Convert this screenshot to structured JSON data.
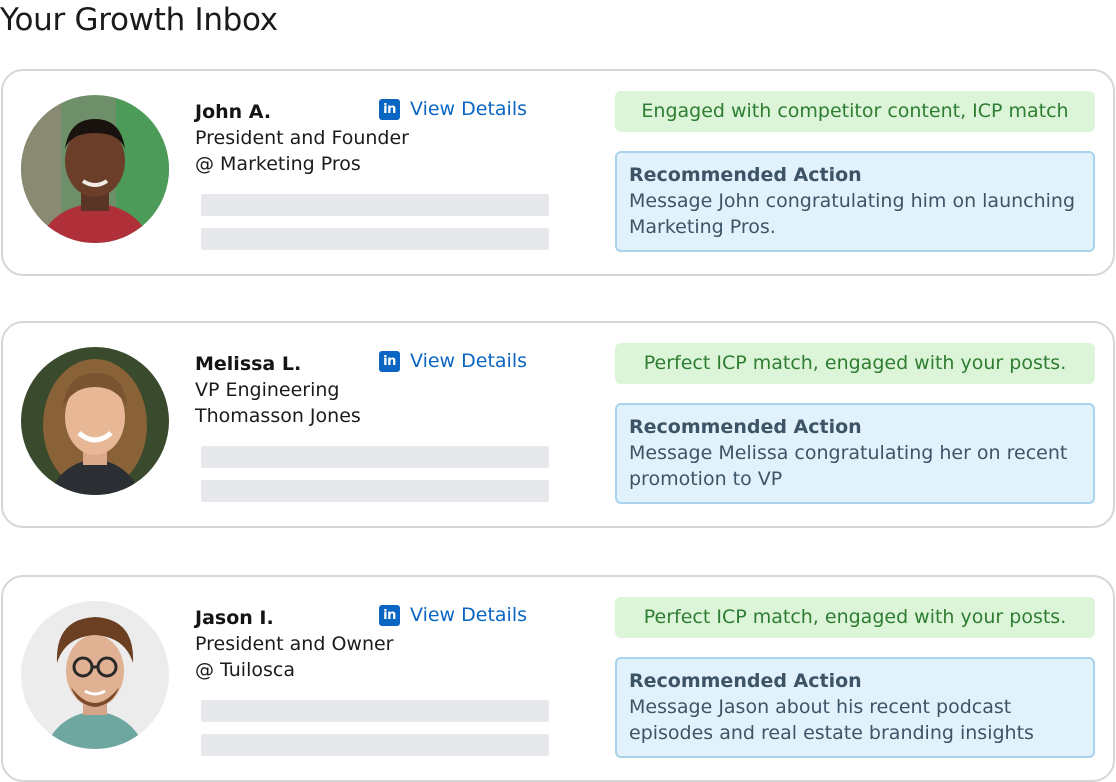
{
  "page": {
    "title": "Your Growth Inbox"
  },
  "common": {
    "view_details": "View Details",
    "linkedin_glyph": "in",
    "recommended_heading": "Recommended Action"
  },
  "colors": {
    "linkedin_blue": "#0a66c2",
    "signal_bg": "#dcf5d8",
    "signal_text": "#2e7d32",
    "action_bg": "#e2f2fc",
    "action_border": "#a9d3ea"
  },
  "leads": [
    {
      "name": "John A.",
      "title": "President and Founder",
      "company": "@ Marketing Pros",
      "signal": "Engaged with competitor content, ICP match",
      "action": "Message John congratulating him on launching Marketing Pros."
    },
    {
      "name": "Melissa L.",
      "title": "VP Engineering",
      "company": "Thomasson Jones",
      "signal": "Perfect ICP match, engaged with your posts.",
      "action": "Message Melissa congratulating her on recent promotion to VP"
    },
    {
      "name": "Jason I.",
      "title": "President and Owner",
      "company": "@ Tuilosca",
      "signal": "Perfect ICP match, engaged with your posts.",
      "action": "Message Jason about his recent podcast episodes and real estate branding insights"
    }
  ]
}
